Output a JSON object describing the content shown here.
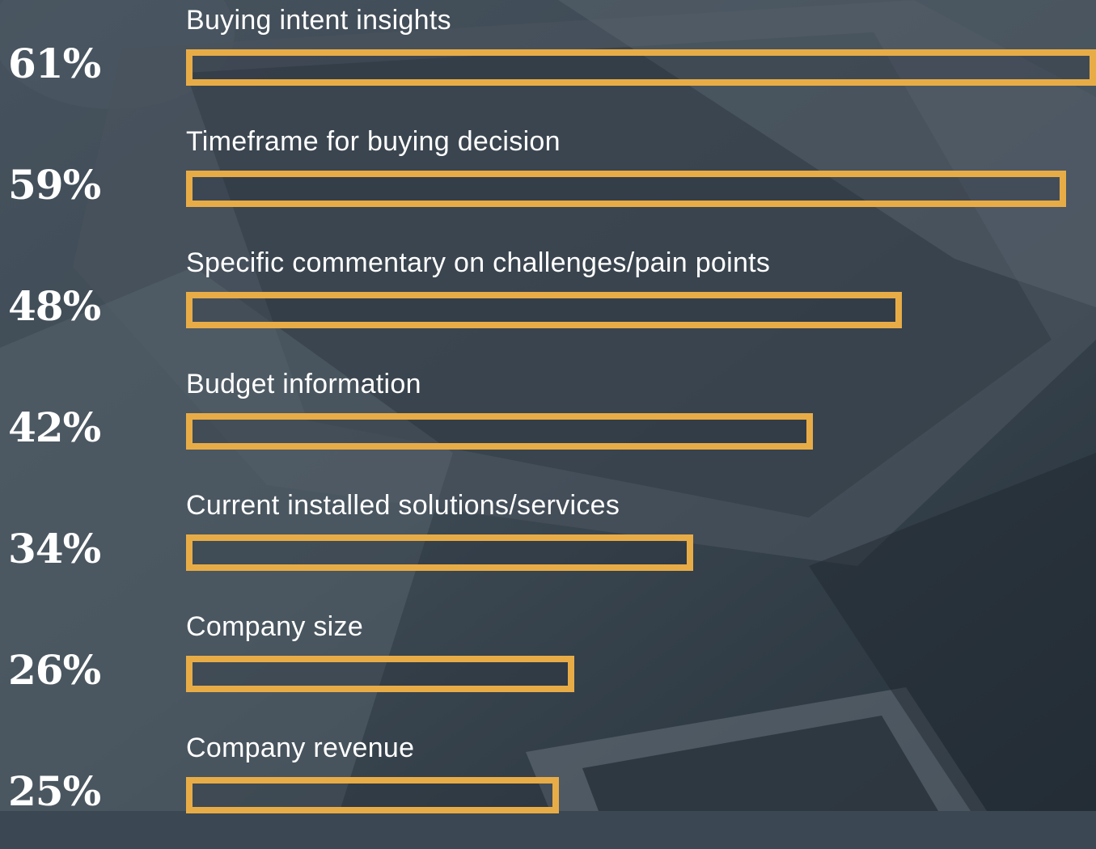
{
  "chart_data": {
    "type": "bar",
    "orientation": "horizontal",
    "categories": [
      "Buying intent insights",
      "Timeframe for buying decision",
      "Specific commentary on challenges/pain points",
      "Budget information",
      "Current installed solutions/services",
      "Company size",
      "Company revenue"
    ],
    "values": [
      61,
      59,
      48,
      42,
      34,
      26,
      25
    ],
    "value_labels": [
      "61%",
      "59%",
      "48%",
      "42%",
      "34%",
      "26%",
      "25%"
    ],
    "xlim": [
      0,
      61
    ],
    "grid": false,
    "legend": "none"
  },
  "colors": {
    "bar_outline": "#e8ac47",
    "text": "#ffffff",
    "background": "#3b4752"
  }
}
